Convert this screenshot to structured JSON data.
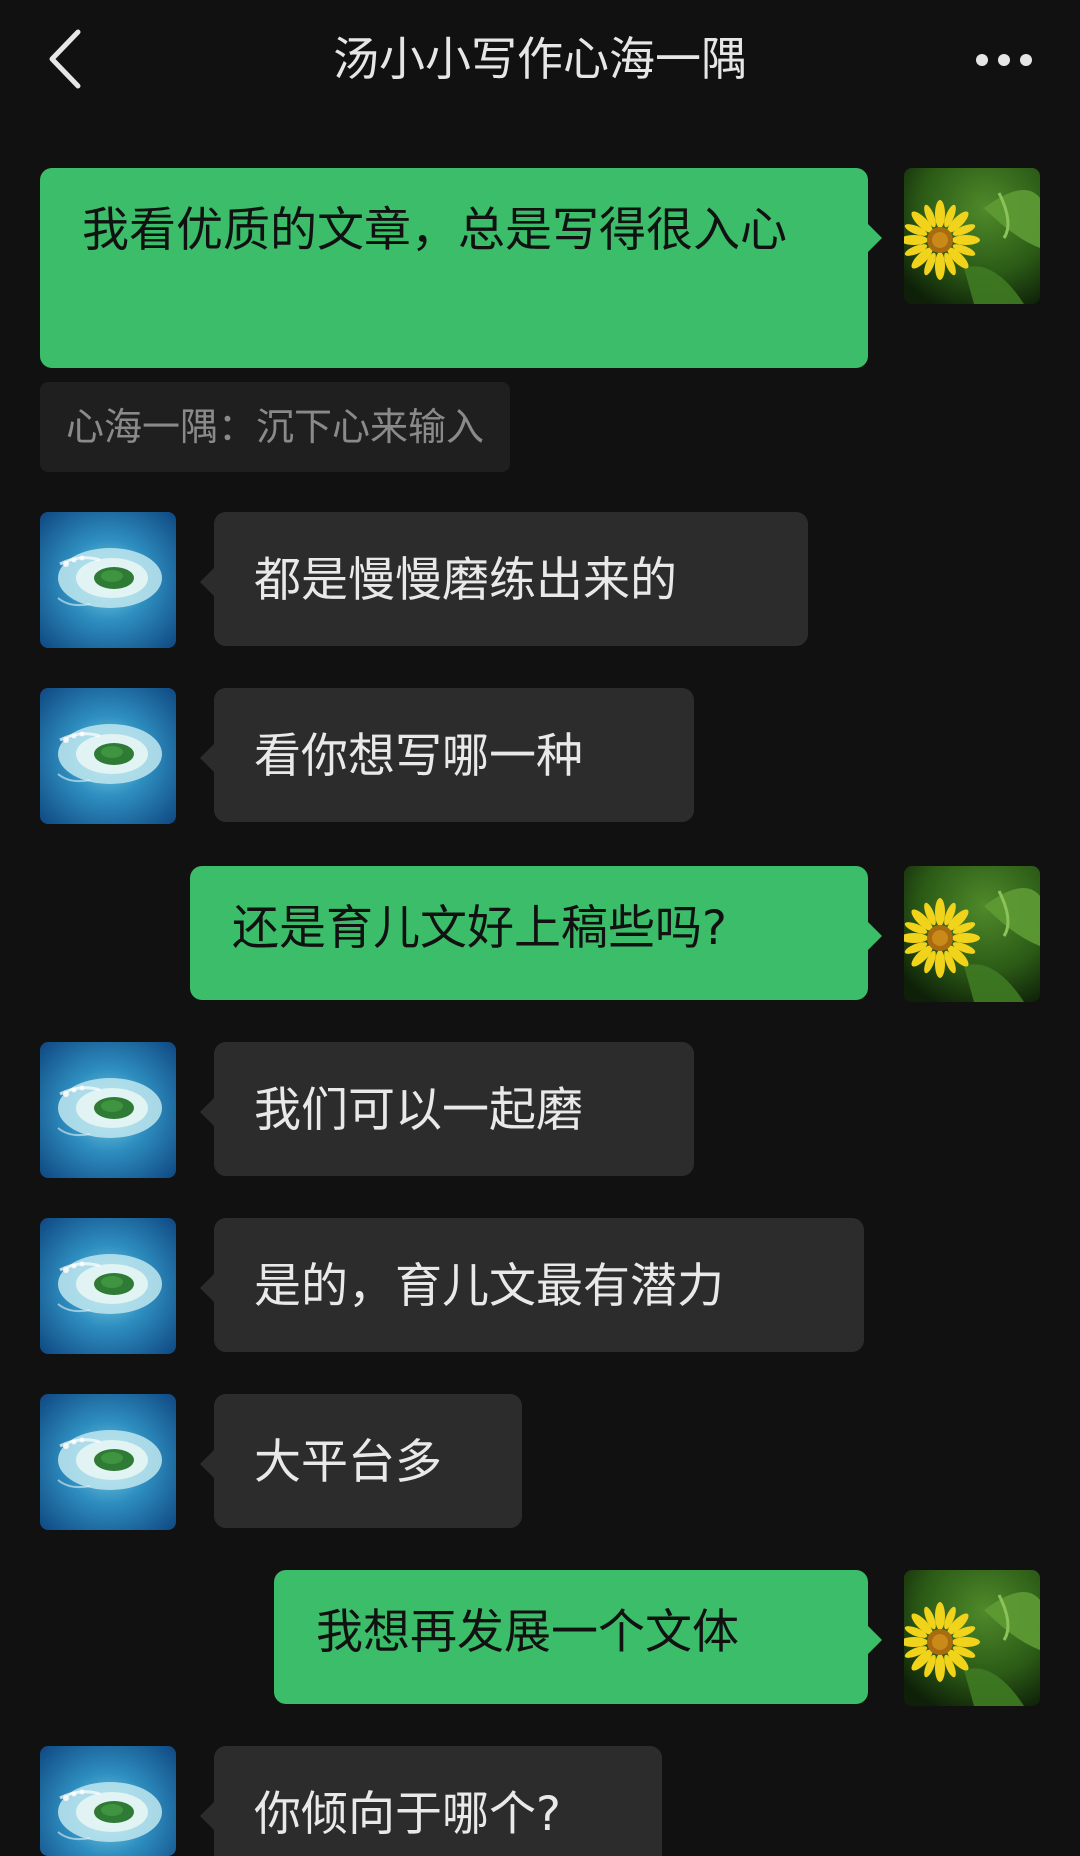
{
  "header": {
    "title": "汤小小写作心海一隅",
    "back_icon": "chevron-left-icon",
    "more_icon": "more-horizontal-icon"
  },
  "colors": {
    "background": "#111111",
    "outgoing_bubble": "#3bbd6a",
    "incoming_bubble": "#2c2c2c",
    "quote_background": "#1f1f1f"
  },
  "messages": [
    {
      "side": "out",
      "text": "我看优质的文章，总是写得很入心",
      "avatar": "sunflower-avatar"
    },
    {
      "side": "in",
      "text": "都是慢慢磨练出来的",
      "avatar": "island-avatar"
    },
    {
      "side": "in",
      "text": "看你想写哪一种",
      "avatar": "island-avatar"
    },
    {
      "side": "out",
      "text": "还是育儿文好上稿些吗?",
      "avatar": "sunflower-avatar"
    },
    {
      "side": "in",
      "text": "我们可以一起磨",
      "avatar": "island-avatar"
    },
    {
      "side": "in",
      "text": "是的，育儿文最有潜力",
      "avatar": "island-avatar"
    },
    {
      "side": "in",
      "text": "大平台多",
      "avatar": "island-avatar"
    },
    {
      "side": "out",
      "text": "我想再发展一个文体",
      "avatar": "sunflower-avatar"
    },
    {
      "side": "in",
      "text": "你倾向于哪个?",
      "avatar": "island-avatar"
    }
  ],
  "quote": {
    "text": "心海一隅：沉下心来输入"
  }
}
